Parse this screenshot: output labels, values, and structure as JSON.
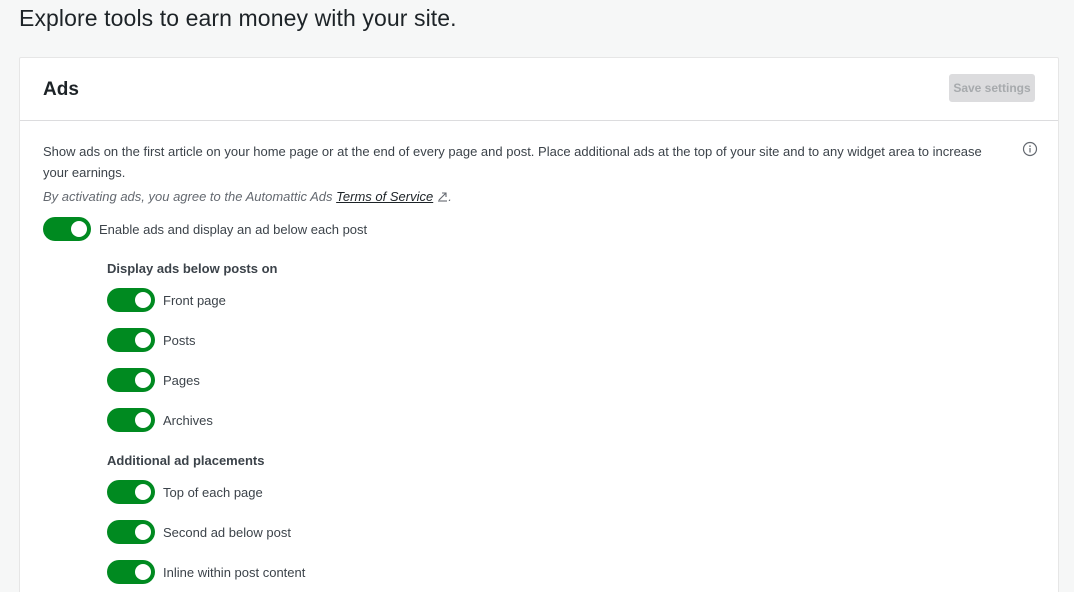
{
  "page": {
    "title": "Explore tools to earn money with your site."
  },
  "card": {
    "title": "Ads",
    "save_label": "Save settings",
    "description": "Show ads on the first article on your home page or at the end of every page and post. Place additional ads at the top of your site and to any widget area to increase your earnings.",
    "tos_prefix": "By activating ads, you agree to the Automattic Ads ",
    "tos_link": "Terms of Service",
    "tos_suffix": ".",
    "enable_toggle": {
      "label": "Enable ads and display an ad below each post",
      "on": true
    },
    "display_section": {
      "heading": "Display ads below posts on",
      "items": [
        {
          "label": "Front page",
          "on": true
        },
        {
          "label": "Posts",
          "on": true
        },
        {
          "label": "Pages",
          "on": true
        },
        {
          "label": "Archives",
          "on": true
        }
      ]
    },
    "additional_section": {
      "heading": "Additional ad placements",
      "items": [
        {
          "label": "Top of each page",
          "on": true
        },
        {
          "label": "Second ad below post",
          "on": true
        },
        {
          "label": "Inline within post content",
          "on": true
        }
      ]
    }
  },
  "colors": {
    "toggle_on": "#008a20",
    "page_bg": "#f6f7f7",
    "card_bg": "#ffffff",
    "button_disabled_bg": "#dcdcde"
  },
  "icons": {
    "info": "info-circle-icon",
    "external": "external-link-icon"
  }
}
